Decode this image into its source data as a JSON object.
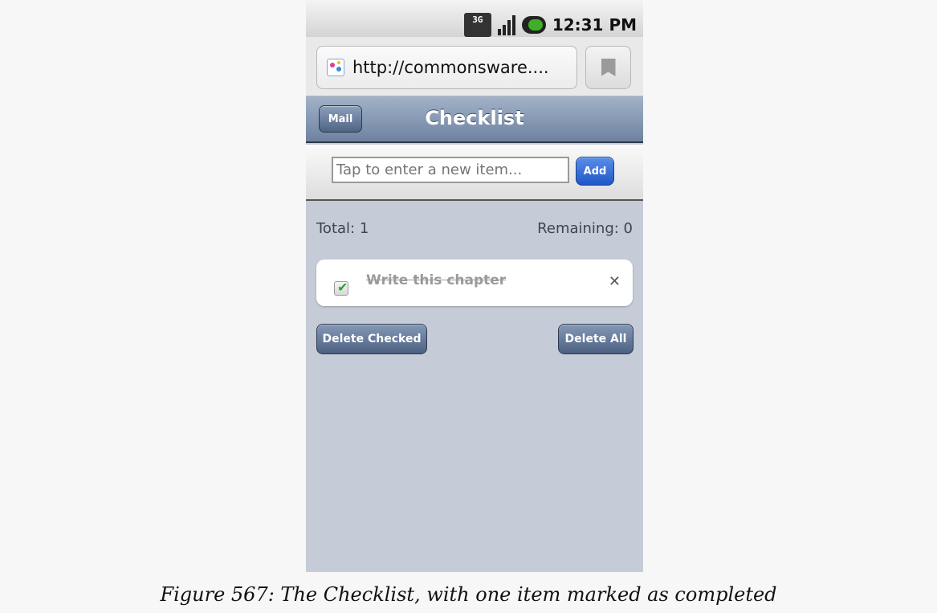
{
  "status_bar": {
    "network": "3G",
    "time": "12:31 PM"
  },
  "browser": {
    "url": "http://commonsware...."
  },
  "header": {
    "left_button": "Mail",
    "title": "Checklist"
  },
  "add_bar": {
    "placeholder": "Tap to enter a new item...",
    "add_label": "Add"
  },
  "counts": {
    "total": "Total: 1",
    "remaining": "Remaining: 0"
  },
  "items": [
    {
      "label": "Write this chapter",
      "checked": true,
      "delete": "✕"
    }
  ],
  "actions": {
    "delete_checked": "Delete Checked",
    "delete_all": "Delete All"
  },
  "caption": "Figure 567: The Checklist, with one item marked as completed",
  "colors": {
    "accent_blue": "#1e57c9",
    "header": "#6e82a0",
    "background": "#c5ccd7",
    "check_green": "#33a02c"
  }
}
